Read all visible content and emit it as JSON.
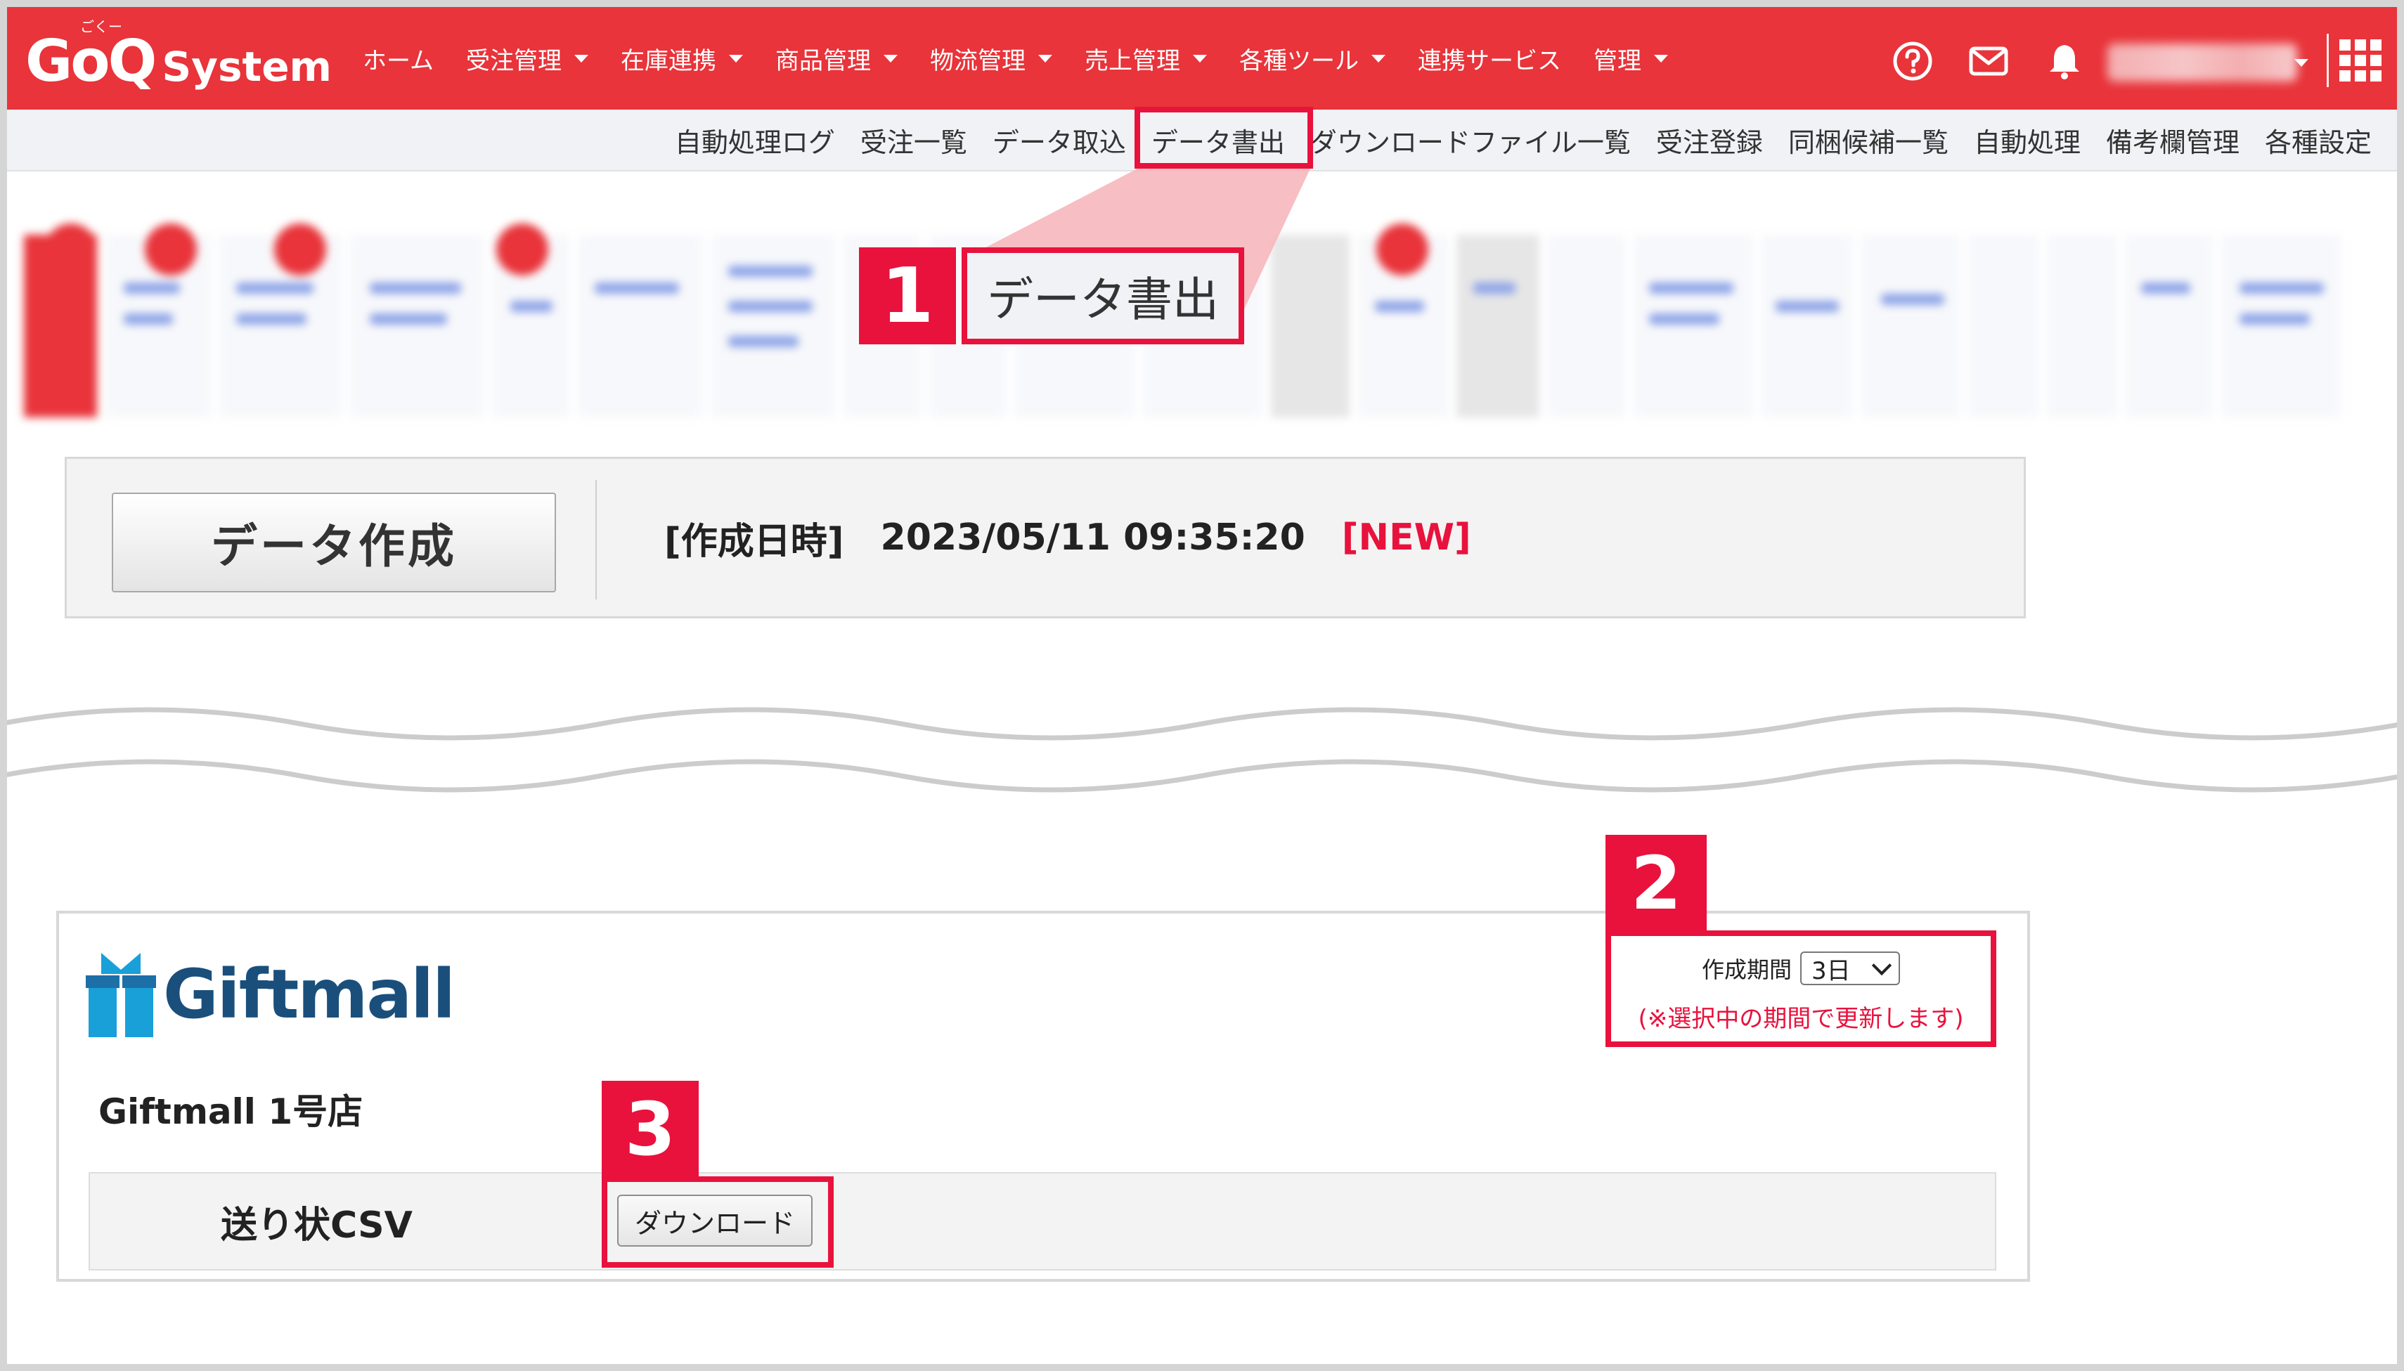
{
  "header": {
    "logo_main": "GoQ",
    "logo_sub": "System",
    "logo_ruby": "ごくー",
    "nav": [
      {
        "label": "ホーム",
        "dropdown": false
      },
      {
        "label": "受注管理",
        "dropdown": true
      },
      {
        "label": "在庫連携",
        "dropdown": true
      },
      {
        "label": "商品管理",
        "dropdown": true
      },
      {
        "label": "物流管理",
        "dropdown": true
      },
      {
        "label": "売上管理",
        "dropdown": true
      },
      {
        "label": "各種ツール",
        "dropdown": true
      },
      {
        "label": "連携サービス",
        "dropdown": false
      },
      {
        "label": "管理",
        "dropdown": true
      }
    ],
    "icons": [
      "help-icon",
      "mail-icon",
      "bell-icon",
      "user-menu",
      "apps-grid-icon"
    ],
    "brand_color": "#e8343a"
  },
  "subnav": {
    "items": [
      "自動処理ログ",
      "受注一覧",
      "データ取込",
      "データ書出",
      "ダウンロードファイル一覧",
      "受注登録",
      "同梱候補一覧",
      "自動処理",
      "備考欄管理",
      "各種設定"
    ],
    "highlighted": "データ書出"
  },
  "callouts": {
    "one": {
      "number": "1",
      "label": "データ書出"
    },
    "two": {
      "number": "2"
    },
    "three": {
      "number": "3"
    },
    "accent": "#e8123d"
  },
  "create_panel": {
    "button_label": "データ作成",
    "created_label": "[作成日時]",
    "created_value": "2023/05/11 09:35:20",
    "new_badge": "[NEW]"
  },
  "giftmall": {
    "logo_text": "Giftmall",
    "store_name": "Giftmall 1号店",
    "period_label": "作成期間",
    "period_value": "3日",
    "period_note": "(※選択中の期間で更新します)",
    "row_label": "送り状CSV",
    "download_label": "ダウンロード"
  }
}
